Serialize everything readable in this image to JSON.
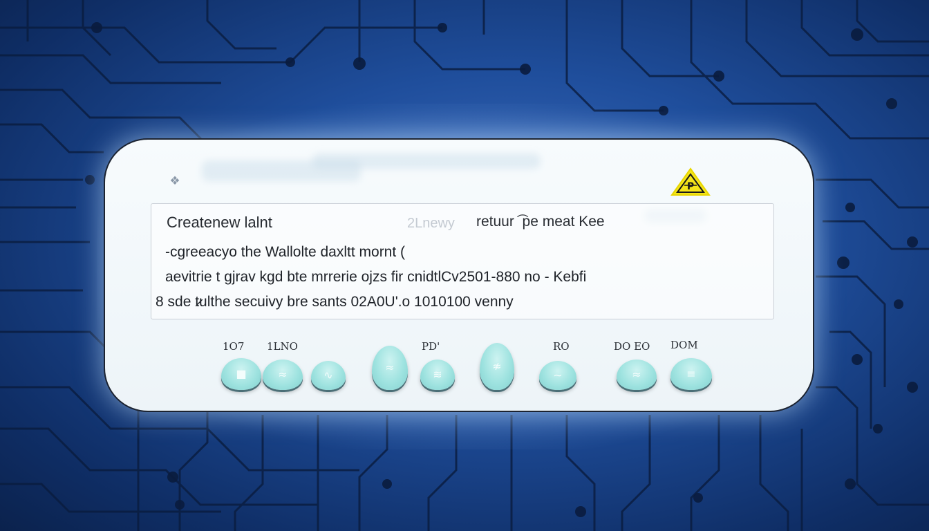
{
  "background": {
    "accent": "#1f4e9c",
    "trace_color": "#0a1c3e"
  },
  "dialog": {
    "warning_icon": "warning-triangle-icon",
    "small_icon": "pin-icon",
    "title": "Createnew lalnt",
    "faint_text": "2Lnewy",
    "right_title": "retuur ͡ pe meat Kee",
    "lines": [
      "-cgreeacyo the Wallolte daxltt mornt (",
      "aevitrie t gjrav kgd bte mrrerie ojzs fir cnidtlCv2501-880 no - Kebfi",
      "8 sde t̷ulthe secuivy bre sants 02A0U'.o 1010100 venny"
    ]
  },
  "keys": [
    {
      "label": "1O7",
      "mark": "■"
    },
    {
      "label": "1LNO",
      "mark": "≈"
    },
    {
      "label": "",
      "mark": "∿"
    },
    {
      "label": "",
      "mark": "≈"
    },
    {
      "label": "PD'",
      "mark": "≋"
    },
    {
      "label": "",
      "mark": "≉"
    },
    {
      "label": "RO",
      "mark": "∼"
    },
    {
      "label": "DO EO",
      "mark": "≈"
    },
    {
      "label": "DOM",
      "mark": "≡"
    }
  ]
}
